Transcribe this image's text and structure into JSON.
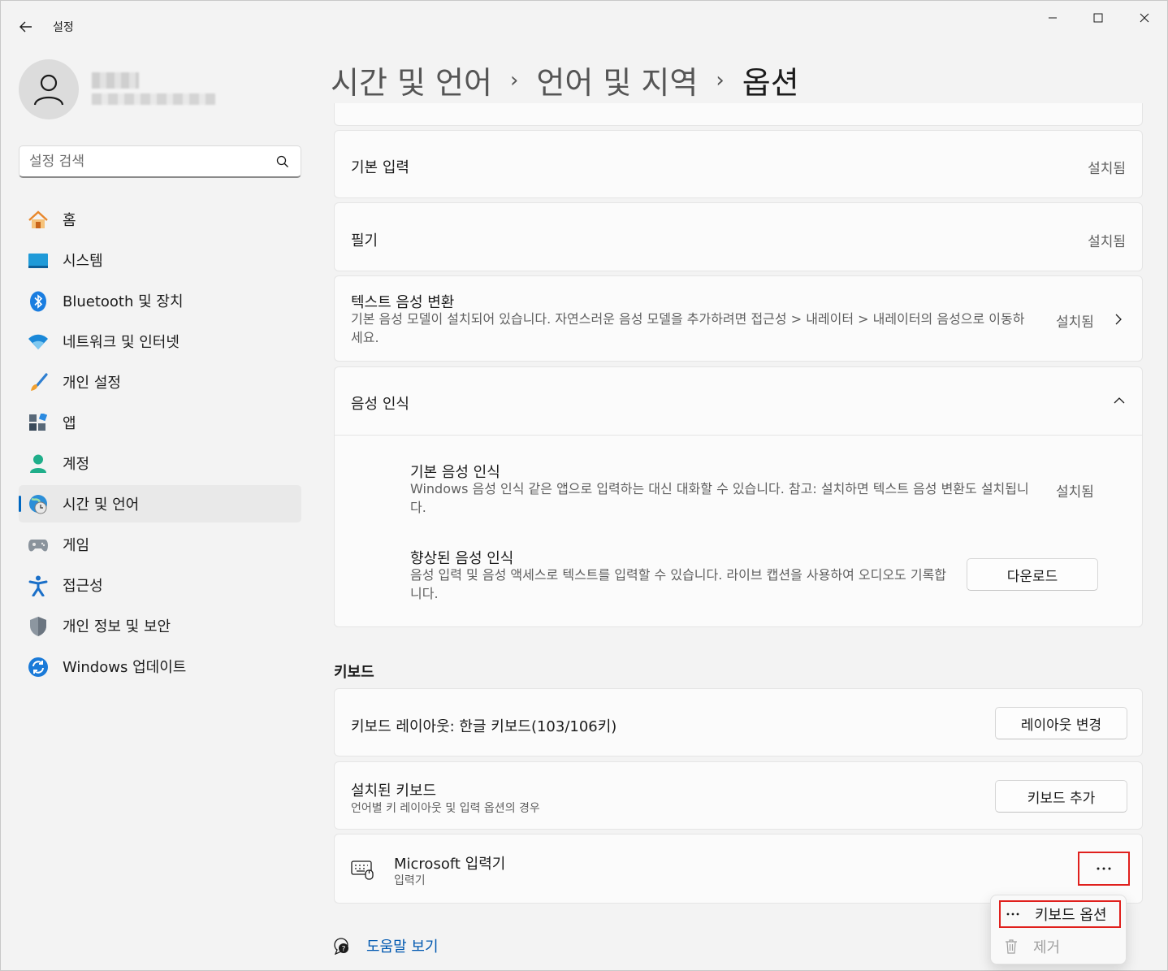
{
  "window": {
    "title": "설정"
  },
  "search": {
    "placeholder": "설정 검색"
  },
  "sidebar": {
    "items": [
      {
        "label": "홈"
      },
      {
        "label": "시스템"
      },
      {
        "label": "Bluetooth 및 장치"
      },
      {
        "label": "네트워크 및 인터넷"
      },
      {
        "label": "개인 설정"
      },
      {
        "label": "앱"
      },
      {
        "label": "계정"
      },
      {
        "label": "시간 및 언어",
        "active": true
      },
      {
        "label": "게임"
      },
      {
        "label": "접근성"
      },
      {
        "label": "개인 정보 및 보안"
      },
      {
        "label": "Windows 업데이트"
      }
    ]
  },
  "breadcrumb": {
    "level1": "시간 및 언어",
    "level2": "언어 및 지역",
    "current": "옵션",
    "separator": "›"
  },
  "features": {
    "basic_input": {
      "title": "기본 입력",
      "status": "설치됨"
    },
    "handwriting": {
      "title": "필기",
      "status": "설치됨"
    },
    "tts": {
      "title": "텍스트 음성 변환",
      "desc": "기본 음성 모델이 설치되어 있습니다. 자연스러운 음성 모델을 추가하려면 접근성 > 내레이터 > 내레이터의 음성으로 이동하세요.",
      "status": "설치됨"
    },
    "speech": {
      "title": "음성 인식",
      "basic": {
        "title": "기본 음성 인식",
        "desc": "Windows 음성 인식 같은 앱으로 입력하는 대신 대화할 수 있습니다. 참고: 설치하면 텍스트 음성 변환도 설치됩니다.",
        "status": "설치됨"
      },
      "enhanced": {
        "title": "향상된 음성 인식",
        "desc": "음성 입력 및 음성 액세스로 텍스트를 입력할 수 있습니다. 라이브 캡션을 사용하여 오디오도 기록합니다.",
        "button": "다운로드"
      }
    }
  },
  "keyboard": {
    "heading": "키보드",
    "layout": {
      "title": "키보드 레이아웃: 한글 키보드(103/106키)",
      "button": "레이아웃 변경"
    },
    "installed": {
      "title": "설치된 키보드",
      "subtitle": "언어별 키 레이아웃 및 입력 옵션의 경우",
      "button": "키보드 추가"
    },
    "ime": {
      "title": "Microsoft 입력기",
      "subtitle": "입력기",
      "more_label": "···"
    }
  },
  "context_menu": {
    "options": "키보드 옵션",
    "remove": "제거"
  },
  "help": {
    "label": "도움말 보기"
  },
  "colors": {
    "accent": "#0067c0",
    "highlight_border": "#e0201d",
    "link": "#0058b0"
  }
}
